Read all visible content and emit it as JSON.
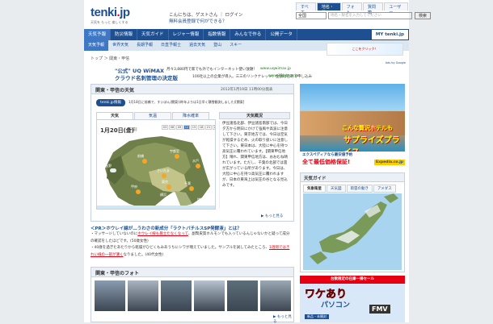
{
  "header": {
    "logo_main": "tenki",
    "logo_dot": ".",
    "logo_tld": "jp",
    "tagline": "天気を もっと 楽しくする",
    "greeting": "こんにちは、ゲストさん ｜ ログイン",
    "register": "無料会員登録で何ができる？",
    "search_tabs": [
      "すべて",
      "地名・駅",
      "フォト",
      "質問箱",
      "ユーザー"
    ],
    "search_tab_active": 1,
    "area_select": "全国",
    "search_placeholder": "地名・駅名を入力してください",
    "search_button": "検索"
  },
  "nav": {
    "items": [
      "天気予報",
      "防災情報",
      "天気ガイド",
      "レジャー情報",
      "指数情報",
      "みんなで作る",
      "公開データ"
    ],
    "active": 0,
    "my": "MY tenki.jp"
  },
  "subnav": {
    "items": [
      "天気予報",
      "世界天気",
      "長期予報",
      "日直予報士",
      "過去天気",
      "登山",
      "スキー"
    ],
    "active": 0
  },
  "breadcrumb": "トップ ＞ 関東・甲信",
  "head_banner": "ここをクリック！",
  "ads_by": "Ads by Google",
  "text_ads": [
    {
      "title": "\"公式\" UQ WiMAX",
      "desc": "月々3,880円で家でも外でもインターネット使い放題！",
      "url": "www.uqwimax.jp"
    },
    {
      "title": "クラウド名刺管理の決定版",
      "desc": "100社以上の企業が導入。三三のリンクナレッジ、金額は名刺で申し込み",
      "url": "www.33lab.co.jp"
    }
  ],
  "weather_box": {
    "title": "関東・甲信の天気",
    "datetime": "2012年1月19日 11時00分発表",
    "badge": "tenki.jp情報",
    "note": "1月18日に前橋で、すいぼん(関東)(昨年よりは1日早く積雪観測しました)[関東]",
    "tabs": [
      "天気",
      "気温",
      "降水確率"
    ],
    "tab_active": 0,
    "map_date": "1月20日(金)",
    "map_sub": "[午前]",
    "time_slots": [
      "03",
      "06",
      "09",
      "12",
      "15",
      "18",
      "21",
      "24"
    ],
    "time_active": 3,
    "map_cities": [
      "前橋",
      "宇都宮",
      "水戸",
      "長野",
      "さいたま",
      "東京",
      "千葉",
      "甲府",
      "横浜",
      "銚子"
    ],
    "summary_title": "天気概況",
    "summary": "伊豆諸島北部、伊豆諸島南部では、今日夕方から明日にかけて強風や高波に注意して下さい。東京地方では、今日は空気が乾燥するため、火の取り扱いに注意して下さい。東日本は、大陸に中心を持つ高気圧に覆われています。【関東甲信地方】晴れ、関東甲信地方は、おおむね晴れています。ただし、千葉の北部では雲が広がっている所があります。今日は、大陸に中心を持つ高気圧に覆われますが、日本の東海上は気圧の谷となる見込みです。",
    "more": "▶ もっと見る"
  },
  "pr": {
    "title": "＜PR＞ホウレイ線が…うわさの新成分「ラクトバチルスSP発酵液」とは？",
    "lines": [
      {
        "pre": "・マッサージしていないのに",
        "hl": "ホウレイ線も目立たなくなって",
        "post": "、副腎皮質ホルモンでも入っているんじゃないかと疑って成分の確認をしたほどです。(50歳女性)"
      },
      {
        "pre": "・40歳を過ぎたあたりから乾燥がひどくもみあうちにシワが増えていました。サンプルを試してみたところ、",
        "hl": "1週間ではきれい線の一部が薄く",
        "post": "なりました。(40代女性)"
      }
    ]
  },
  "photo_box": {
    "title": "関東・甲信のフォト",
    "more": "▶ もっと見る",
    "photo_colors": [
      "#8a9bb0",
      "#a9b4bf",
      "#6d7f8f",
      "#b7c3cf",
      "#5e6f7a",
      "#9aa8b4"
    ]
  },
  "ad_resort": {
    "words": "こんな贅沢ホテルも",
    "big": "サプライズプライス",
    "line1": "エクスペディアなら最安値予約",
    "line2": "全て最低価格保証!",
    "logo": "Expedia.co.jp"
  },
  "tenki_guide": {
    "title": "天気ガイド",
    "tabs": [
      "気象衛星",
      "天気図",
      "雨雲の動き",
      "アメダス"
    ],
    "tab_active": 0
  },
  "ad_pc": {
    "top": "台数限定の在庫一掃セール",
    "big": "ワケあり",
    "big2": "パソコン",
    "brand": "FMV",
    "line": "新品・未開封"
  }
}
